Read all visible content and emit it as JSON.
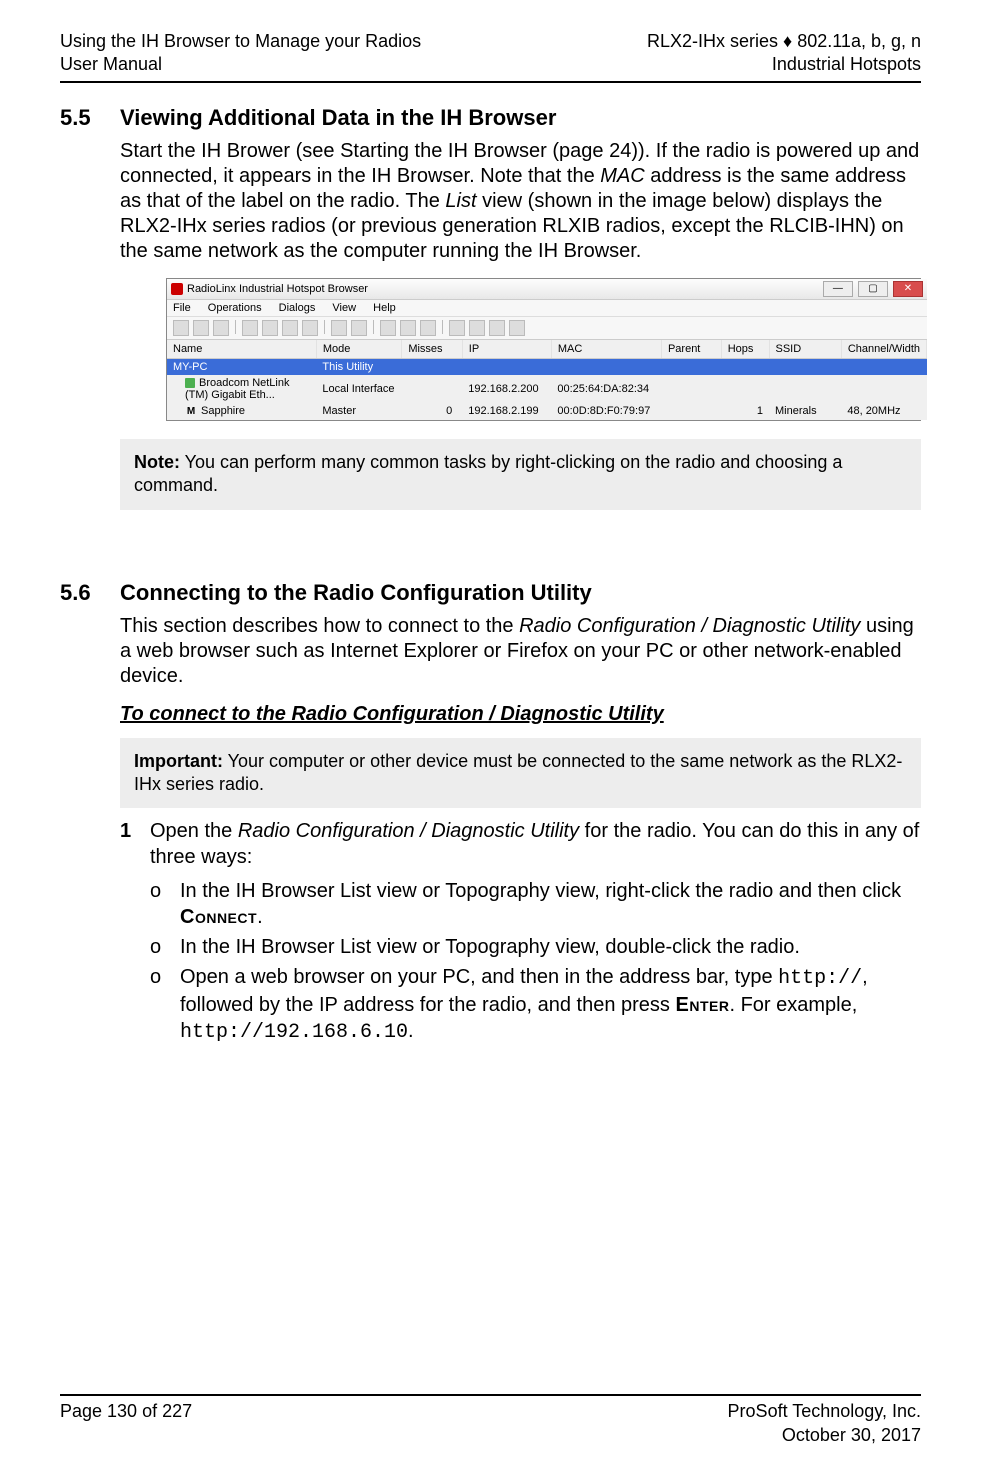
{
  "header": {
    "left1": "Using the IH Browser to Manage your Radios",
    "left2": "User Manual",
    "right1": "RLX2-IHx series ♦ 802.11a, b, g, n",
    "right2": "Industrial Hotspots"
  },
  "sec55": {
    "num": "5.5",
    "title": "Viewing Additional Data in the IH Browser",
    "p_a": "Start the IH Brower (see Starting the IH Browser (page 24)). If the radio is powered up and connected, it appears in the IH Browser. Note that the ",
    "p_b_i": "MAC",
    "p_c": " address is the same address as that of the label on the radio. The ",
    "p_d_i": "List",
    "p_e": " view (shown in the image below) displays the RLX2-IHx series radios (or previous generation RLXIB radios, except the RLCIB-IHN) on the same network as the computer running the IH Browser."
  },
  "screenshot": {
    "title": "RadioLinx Industrial Hotspot Browser",
    "menu": [
      "File",
      "Operations",
      "Dialogs",
      "View",
      "Help"
    ],
    "cols": [
      "Name",
      "Mode",
      "Misses",
      "IP",
      "MAC",
      "Parent",
      "Hops",
      "SSID",
      "Channel/Width"
    ],
    "row_blue": {
      "name": "MY-PC",
      "mode": "This Utility"
    },
    "row_dev": {
      "name": "Broadcom NetLink (TM) Gigabit Eth...",
      "mode": "Local Interface",
      "ip": "192.168.2.200",
      "mac": "00:25:64:DA:82:34"
    },
    "row_radio": {
      "name": "Sapphire",
      "mode": "Master",
      "misses": "0",
      "ip": "192.168.2.199",
      "mac": "00:0D:8D:F0:79:97",
      "hops": "1",
      "ssid": "Minerals",
      "cw": "48, 20MHz"
    }
  },
  "note55": {
    "bold": "Note:",
    "text": " You can perform many common tasks by right-clicking on the radio and choosing a command."
  },
  "sec56": {
    "num": "5.6",
    "title": "Connecting to the Radio Configuration Utility",
    "p_a": "This section describes how to connect to the ",
    "p_b_i": "Radio Configuration / Diagnostic Utility",
    "p_c": " using a web browser such as Internet Explorer or Firefox on your PC or other network-enabled device.",
    "sub": "To connect to the Radio Configuration / Diagnostic Utility"
  },
  "imp56": {
    "bold": "Important:",
    "text": " Your computer or other device must be connected to the same network as the RLX2-IHx series radio."
  },
  "steps": {
    "num1": "1",
    "s1_a": "Open the ",
    "s1_b_i": "Radio Configuration / Diagnostic Utility",
    "s1_c": " for the radio. You can do this in any of three ways:",
    "s1o1_a": "In the IH Browser List view or Topography view, right-click the radio and then click ",
    "s1o1_b_sc": "Connect",
    "s1o1_c": ".",
    "s1o2": "In the IH Browser List view or Topography view, double-click the radio.",
    "s1o3_a": "Open a web browser on your PC, and then in the address bar, type ",
    "s1o3_b_m": "http://",
    "s1o3_c": ", followed by the IP address for the radio, and then press ",
    "s1o3_d_sc": "Enter",
    "s1o3_e": ". For example, ",
    "s1o3_f_m": "http://192.168.6.10",
    "s1o3_g": "."
  },
  "footer": {
    "left": "Page 130 of 227",
    "right1": "ProSoft Technology, Inc.",
    "right2": "October 30, 2017"
  }
}
